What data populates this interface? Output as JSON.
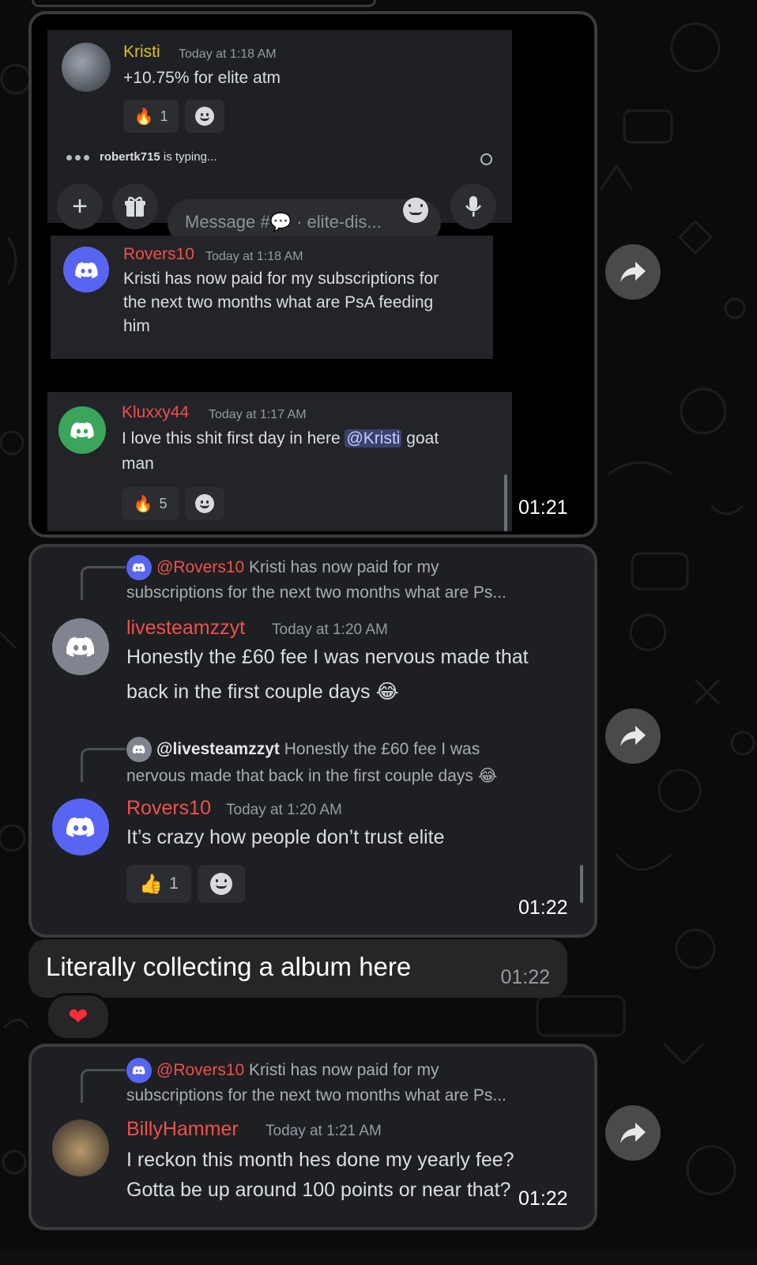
{
  "colors": {
    "kristi_name": "#e0c020",
    "red_name": "#f0504a",
    "blurple": "#5865f2",
    "green": "#3ba55c"
  },
  "bubble1": {
    "kristi": {
      "name": "Kristi",
      "time": "Today at 1:18 AM",
      "text": "+10.75% for elite atm",
      "reaction_emoji": "🔥",
      "reaction_count": "1"
    },
    "typing_user": "robertk715",
    "typing_suffix": " is typing...",
    "composer_placeholder": "Message #💬 · elite-dis...",
    "rovers": {
      "name": "Rovers10",
      "time": "Today at 1:18 AM",
      "text_lines": [
        "Kristi has now paid for my subscriptions for",
        "the next two months what are PsA feeding",
        "him"
      ]
    },
    "kluxxy": {
      "name": "Kluxxy44",
      "time": "Today at 1:17 AM",
      "text_before": "I love this shit first day in here ",
      "mention": "@Kristi",
      "text_after": " goat",
      "text_line2": "man",
      "reaction_emoji": "🔥",
      "reaction_count": "5"
    },
    "timestamp": "01:21"
  },
  "bubble2": {
    "reply1": {
      "name": "@Rovers10",
      "text_line1": " Kristi has now paid for my",
      "text_line2": "subscriptions for the next two months what are Ps..."
    },
    "msg1": {
      "name": "livesteamzzyt",
      "time": "Today at 1:20 AM",
      "line1": "Honestly the £60 fee I was nervous made that",
      "line2": "back in the first couple days 😂"
    },
    "reply2": {
      "name": "@livesteamzzyt",
      "text_line1": " Honestly the £60 fee I was",
      "text_line2": "nervous made that back in the first couple days 😂"
    },
    "msg2": {
      "name": "Rovers10",
      "time": "Today at 1:20 AM",
      "line1": "It’s crazy how people don’t trust elite",
      "reaction_emoji": "👍",
      "reaction_count": "1"
    },
    "timestamp": "01:22"
  },
  "bubble3": {
    "text": "Literally collecting a album here",
    "timestamp": "01:22",
    "reaction": "❤"
  },
  "bubble4": {
    "reply": {
      "name": "@Rovers10",
      "text_line1": " Kristi has now paid for my",
      "text_line2": "subscriptions for the next two months what are Ps..."
    },
    "msg": {
      "name": "BillyHammer",
      "time": "Today at 1:21 AM",
      "line1": "I reckon this month hes done my yearly fee?",
      "line2": "Gotta be up around 100 points or near that?"
    },
    "timestamp": "01:22"
  }
}
